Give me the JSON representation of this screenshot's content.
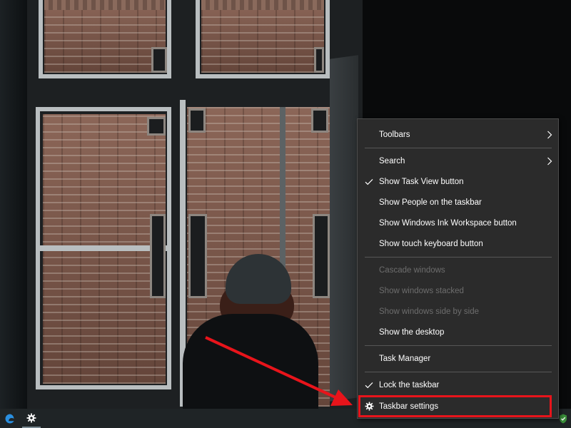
{
  "context_menu": {
    "items": [
      {
        "label": "Toolbars",
        "submenu_icon": "chevron-right-icon"
      },
      {
        "label": "Search",
        "submenu_icon": "chevron-right-icon"
      },
      {
        "label": "Show Task View button",
        "checked": true
      },
      {
        "label": "Show People on the taskbar",
        "checked": false
      },
      {
        "label": "Show Windows Ink Workspace button",
        "checked": false
      },
      {
        "label": "Show touch keyboard button",
        "checked": false
      },
      {
        "label": "Cascade windows",
        "disabled": true
      },
      {
        "label": "Show windows stacked",
        "disabled": true
      },
      {
        "label": "Show windows side by side",
        "disabled": true
      },
      {
        "label": "Show the desktop"
      },
      {
        "label": "Task Manager"
      },
      {
        "label": "Lock the taskbar",
        "checked": true
      },
      {
        "label": "Taskbar settings",
        "icon": "gear-icon",
        "highlighted": true
      }
    ]
  },
  "taskbar": {
    "apps": [
      {
        "icon": "edge-browser-icon"
      },
      {
        "icon": "settings-gear-icon",
        "active": true
      }
    ],
    "tray": [
      {
        "icon": "security-shield-icon"
      }
    ]
  },
  "colors": {
    "menu_bg": "#2b2b2b",
    "menu_text": "#ffffff",
    "disabled_text": "#6d6d6d",
    "annotation_red": "#e8141b",
    "taskbar_bg": "#1f2426",
    "edge_blue": "#2a8fe0"
  }
}
